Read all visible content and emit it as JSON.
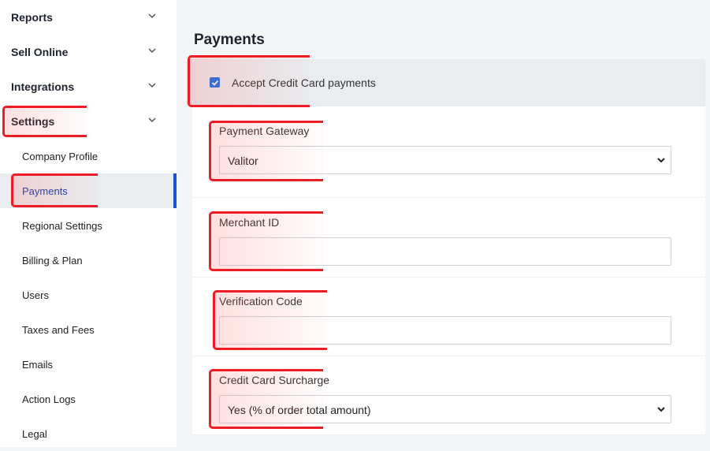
{
  "sidebar": {
    "groups": [
      {
        "label": "Reports"
      },
      {
        "label": "Sell Online"
      },
      {
        "label": "Integrations"
      },
      {
        "label": "Settings"
      }
    ],
    "settings_items": [
      {
        "label": "Company Profile"
      },
      {
        "label": "Payments"
      },
      {
        "label": "Regional Settings"
      },
      {
        "label": "Billing & Plan"
      },
      {
        "label": "Users"
      },
      {
        "label": "Taxes and Fees"
      },
      {
        "label": "Emails"
      },
      {
        "label": "Action Logs"
      },
      {
        "label": "Legal"
      }
    ],
    "active_item": "Payments"
  },
  "main": {
    "title": "Payments",
    "accept_checkbox": {
      "label": "Accept Credit Card payments",
      "checked": true
    },
    "payment_gateway": {
      "label": "Payment Gateway",
      "value": "Valitor"
    },
    "merchant_id": {
      "label": "Merchant ID",
      "value": ""
    },
    "verification_code": {
      "label": "Verification Code",
      "value": ""
    },
    "surcharge": {
      "label": "Credit Card Surcharge",
      "value": "Yes (% of order total amount)"
    }
  },
  "colors": {
    "accent": "#1a4fd1",
    "highlight": "#ee1c24",
    "checkbox": "#1a73e8"
  }
}
